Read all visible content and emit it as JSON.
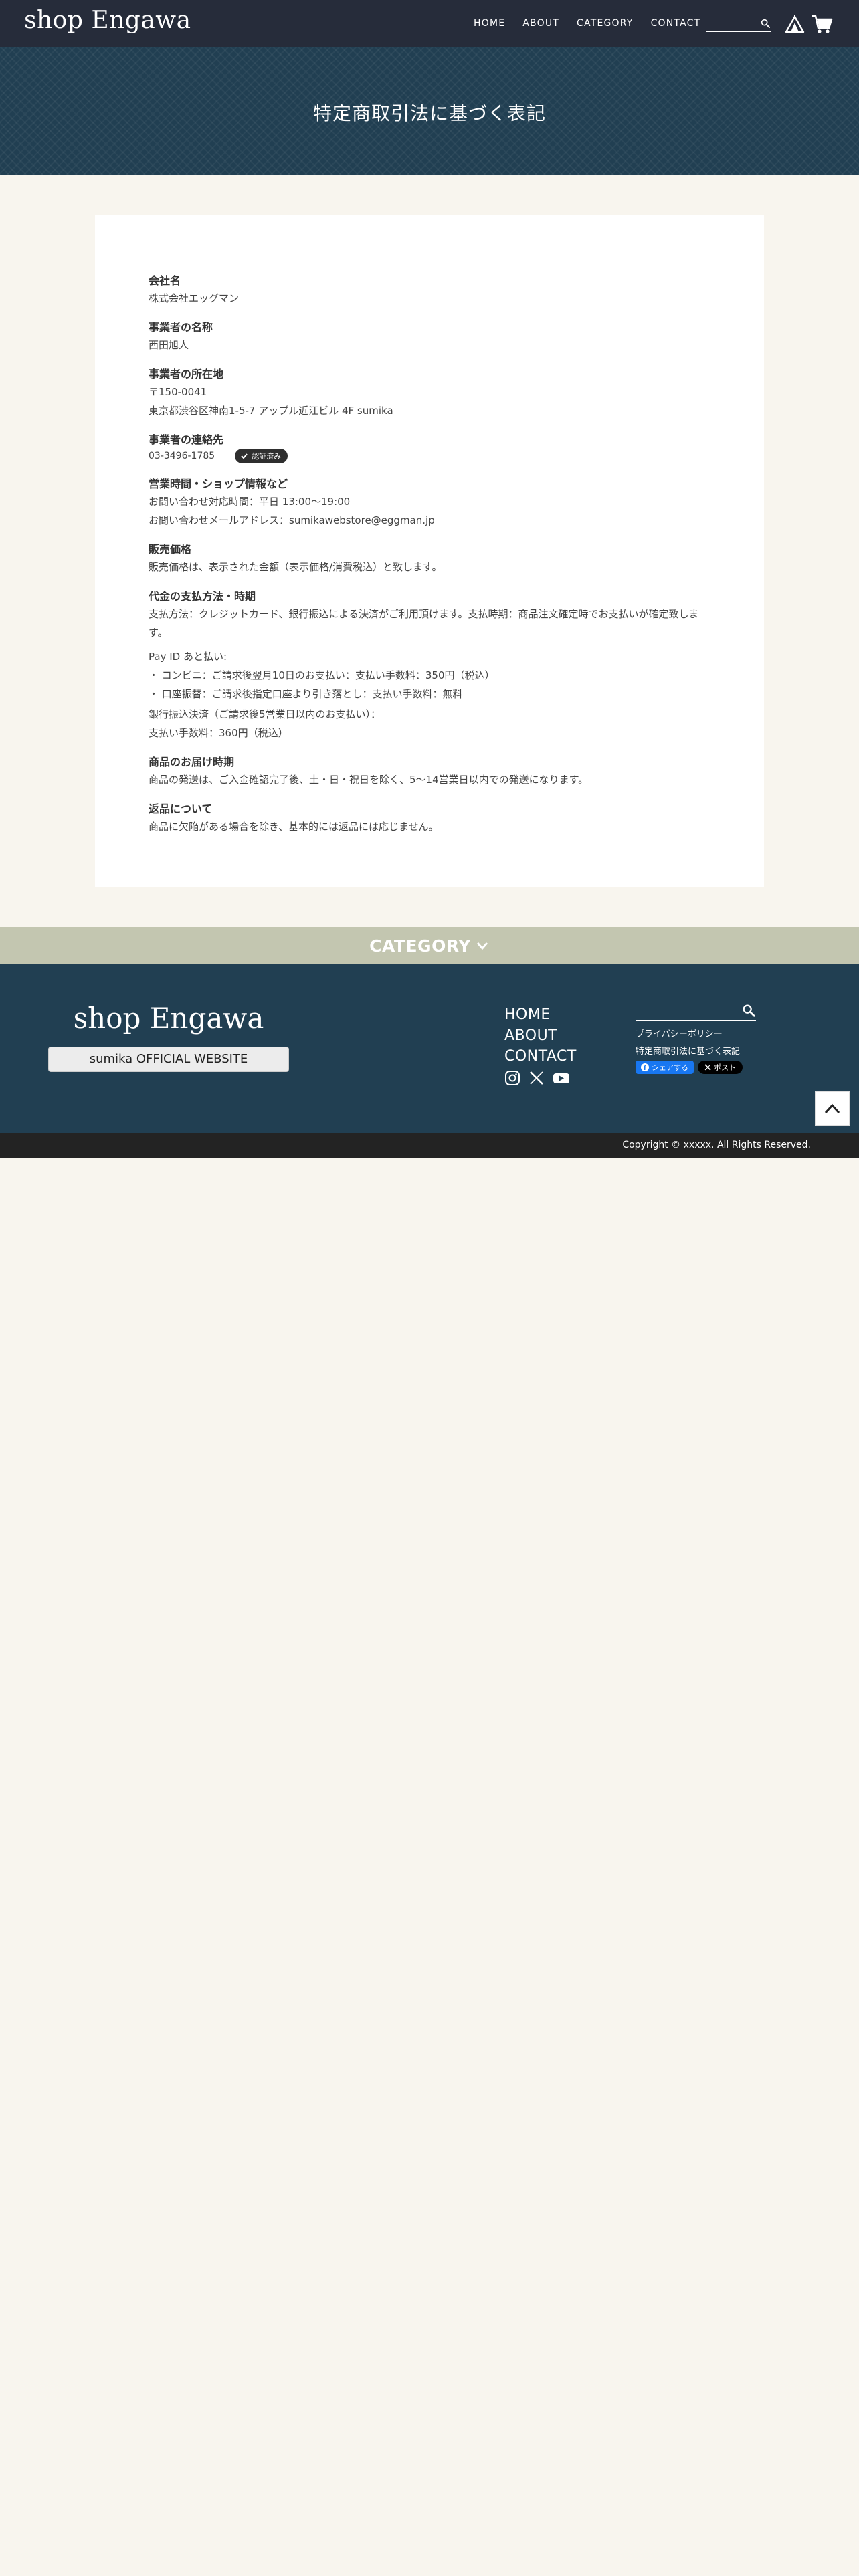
{
  "header": {
    "logo": "shop Engawa",
    "nav": [
      {
        "label": "HOME"
      },
      {
        "label": "ABOUT"
      },
      {
        "label": "CATEGORY"
      },
      {
        "label": "CONTACT"
      }
    ],
    "search": {
      "placeholder": ""
    },
    "icons": {
      "search": "search-icon",
      "tent": "tent-icon",
      "cart": "cart-icon"
    }
  },
  "hero": {
    "title": "特定商取引法に基づく表記"
  },
  "legal": {
    "company": {
      "heading": "会社名",
      "value": "株式会社エッグマン"
    },
    "representative": {
      "heading": "事業者の名称",
      "value": "西田旭人"
    },
    "address": {
      "heading": "事業者の所在地",
      "postal": "〒150-0041",
      "value": "東京都渋谷区神南1-5-7 アップル近江ビル 4F sumika"
    },
    "contact": {
      "heading": "事業者の連絡先",
      "phone": "03-3496-1785",
      "badge": "認証済み"
    },
    "hours": {
      "heading": "営業時間・ショップ情報など",
      "line1": "お問い合わせ対応時間：平日 13:00〜19:00",
      "line2": "お問い合わせメールアドレス：sumikawebstore@eggman.jp"
    },
    "price": {
      "heading": "販売価格",
      "value": "販売価格は、表示された金額（表示価格/消費税込）と致します。"
    },
    "payment": {
      "heading": "代金の支払方法・時期",
      "line1": "支払方法：クレジットカード、銀行振込による決済がご利用頂けます。支払時期：商品注文確定時でお支払いが確定致します。",
      "payid_title": "Pay ID あと払い:",
      "payid_item1": "・ コンビニ：ご請求後翌月10日のお支払い：支払い手数料：350円（税込）",
      "payid_item2": "・ 口座振替：ご請求後指定口座より引き落とし：支払い手数料：無料",
      "bank_line1": "銀行振込決済（ご請求後5営業日以内のお支払い）：",
      "bank_line2": "支払い手数料：360円（税込）"
    },
    "delivery": {
      "heading": "商品のお届け時期",
      "value": "商品の発送は、ご入金確認完了後、土・日・祝日を除く、5〜14営業日以内での発送になります。"
    },
    "returns": {
      "heading": "返品について",
      "value": "商品に欠陥がある場合を除き、基本的には返品には応じません。"
    }
  },
  "category_band": {
    "label": "CATEGORY",
    "icon": "chevron-down-icon"
  },
  "footer": {
    "logo": "shop Engawa",
    "official_button": "sumika OFFICIAL WEBSITE",
    "nav": [
      {
        "label": "HOME"
      },
      {
        "label": "ABOUT"
      },
      {
        "label": "CONTACT"
      }
    ],
    "social_icons": [
      "instagram-icon",
      "x-icon",
      "youtube-icon"
    ],
    "search": {
      "placeholder": ""
    },
    "links": [
      {
        "label": "プライバシーポリシー"
      },
      {
        "label": "特定商取引法に基づく表記"
      }
    ],
    "share_facebook": "シェアする",
    "share_x": "ポスト",
    "copyright": "Copyright © xxxxx. All Rights Reserved."
  },
  "colors": {
    "header_bg": "#262c3a",
    "hero_bg": "#213f52",
    "page_bg": "#f8f5ee",
    "category_band_bg": "#c3c6b0",
    "footer_bg": "#213f52",
    "copyright_bg": "#232323"
  }
}
